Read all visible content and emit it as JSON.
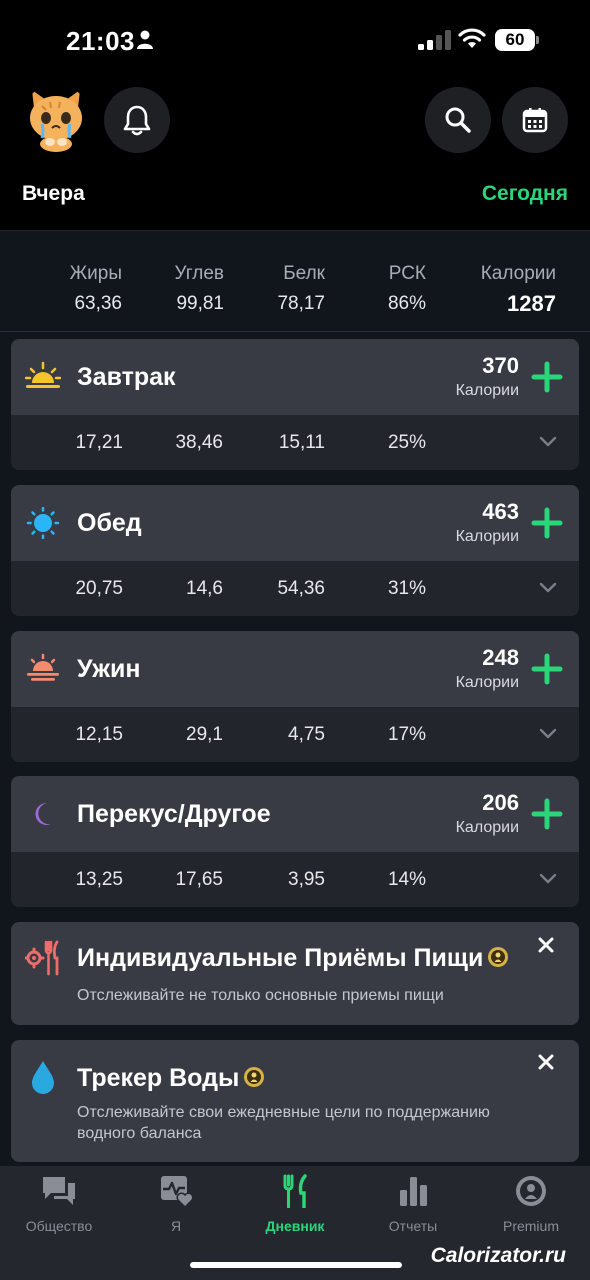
{
  "status": {
    "time": "21:03",
    "battery": "60"
  },
  "header": {
    "prev_day": "Вчера",
    "next_day": "Сегодня"
  },
  "summary": {
    "fat": {
      "label": "Жиры",
      "value": "63,36"
    },
    "carbs": {
      "label": "Углев",
      "value": "99,81"
    },
    "protein": {
      "label": "Белк",
      "value": "78,17"
    },
    "rdi": {
      "label": "РСК",
      "value": "86%"
    },
    "calories": {
      "label": "Калории",
      "value": "1287"
    }
  },
  "meals": [
    {
      "name": "Завтрак",
      "calories": "370",
      "cal_label": "Калории",
      "icon": "sunrise-icon",
      "fat": "17,21",
      "carbs": "38,46",
      "protein": "15,11",
      "rdi": "25%"
    },
    {
      "name": "Обед",
      "calories": "463",
      "cal_label": "Калории",
      "icon": "sun-icon",
      "fat": "20,75",
      "carbs": "14,6",
      "protein": "54,36",
      "rdi": "31%"
    },
    {
      "name": "Ужин",
      "calories": "248",
      "cal_label": "Калории",
      "icon": "sunset-icon",
      "fat": "12,15",
      "carbs": "29,1",
      "protein": "4,75",
      "rdi": "17%"
    },
    {
      "name": "Перекус/Другое",
      "calories": "206",
      "cal_label": "Калории",
      "icon": "moon-icon",
      "fat": "13,25",
      "carbs": "17,65",
      "protein": "3,95",
      "rdi": "14%"
    }
  ],
  "promos": [
    {
      "title": "Индивидуальные Приёмы Пищи",
      "subtitle": "Отслеживайте не только основные приемы пищи",
      "icon": "fork-knife-gear-icon"
    },
    {
      "title": "Трекер Воды",
      "subtitle": "Отслеживайте свои ежедневные цели по поддержанию водного баланса",
      "icon": "water-drop-icon"
    }
  ],
  "tabs": [
    {
      "label": "Общество",
      "icon": "chat-bubbles-icon",
      "active": false
    },
    {
      "label": "Я",
      "icon": "heart-pulse-icon",
      "active": false
    },
    {
      "label": "Дневник",
      "icon": "fork-knife-icon",
      "active": true
    },
    {
      "label": "Отчеты",
      "icon": "bar-chart-icon",
      "active": false
    },
    {
      "label": "Premium",
      "icon": "premium-badge-icon",
      "active": false
    }
  ],
  "watermark": "Calorizator.ru",
  "colors": {
    "accent": "#2bd57a",
    "background": "#11151c",
    "card": "#383a44",
    "card_row": "#23252d",
    "tabbar": "#25272e"
  }
}
